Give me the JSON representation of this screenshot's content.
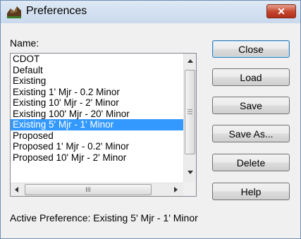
{
  "window": {
    "title": "Preferences",
    "close_glyph": "✕"
  },
  "name_label": "Name:",
  "list": {
    "items": [
      "CDOT",
      "Default",
      "Existing",
      "Existing 1' Mjr - 0.2 Minor",
      "Existing 10' Mjr - 2' Minor",
      "Existing 100' Mjr - 20' Minor",
      "Existing 5' Mjr - 1' Minor",
      "Proposed",
      "Proposed 1' Mjr - 0.2' Minor",
      "Proposed 10' Mjr - 2' Minor"
    ],
    "selected_index": 6,
    "h_thumb_glyph": "III"
  },
  "buttons": {
    "close": "Close",
    "load": "Load",
    "save": "Save",
    "save_as": "Save As...",
    "delete": "Delete",
    "help": "Help"
  },
  "status": {
    "active_preference": "Active Preference: Existing 5' Mjr - 1' Minor"
  },
  "colors": {
    "selection": "#3399ff",
    "close_button": "#c4432b"
  }
}
